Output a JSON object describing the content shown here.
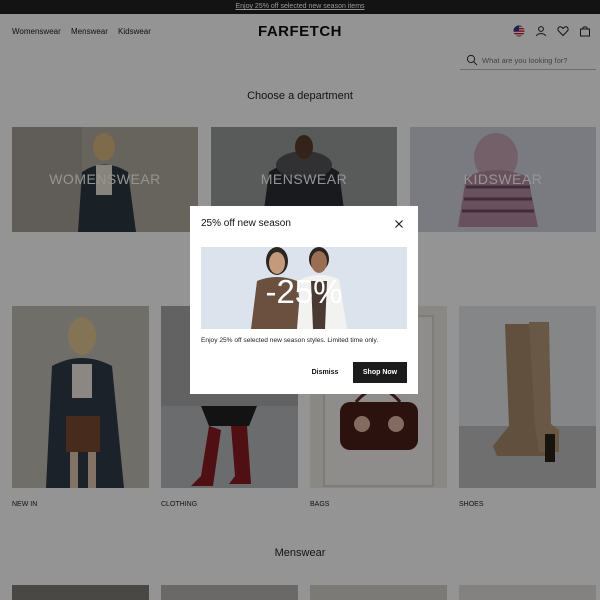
{
  "announcement": "Enjoy 25% off selected new season items",
  "header": {
    "nav": [
      "Womenswear",
      "Menswear",
      "Kidswear"
    ],
    "logo": "FARFETCH",
    "icons": [
      "us-flag-icon",
      "user-icon",
      "heart-icon",
      "bag-icon"
    ]
  },
  "search": {
    "placeholder": "What are you looking for?"
  },
  "departments": {
    "title": "Choose a department",
    "items": [
      "WOMENSWEAR",
      "MENSWEAR",
      "KIDSWEAR"
    ]
  },
  "categories": [
    "NEW IN",
    "CLOTHING",
    "BAGS",
    "SHOES"
  ],
  "menswear_section": {
    "title": "Menswear"
  },
  "modal": {
    "title": "25% off new season",
    "banner_text": "-25%",
    "description": "Enjoy 25% off selected new season styles. Limited time only.",
    "dismiss": "Dismiss",
    "shop_now": "Shop Now"
  },
  "colors": {
    "overlay": "rgba(0,0,0,0.42)",
    "button": "#1c1c1c",
    "banner_bg": "#dfe5ee"
  }
}
